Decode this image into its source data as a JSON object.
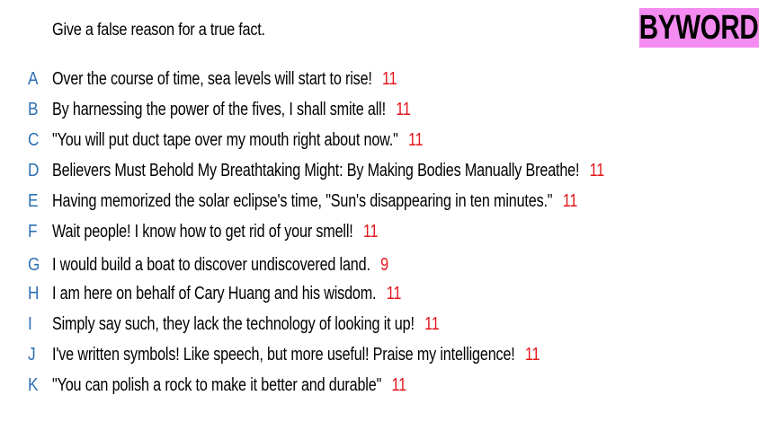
{
  "prompt": "Give a false reason for a true fact.",
  "logo_text": "BYWORD",
  "colors": {
    "letter": "#2d6fb3",
    "score": "#e3161b",
    "logo_bg": "#f48bf0"
  },
  "entries": [
    {
      "letter": "A",
      "text": "Over the course of time, sea levels will start to rise!",
      "score": "11"
    },
    {
      "letter": "B",
      "text": "By harnessing the power of the fives, I shall smite all!",
      "score": "11"
    },
    {
      "letter": "C",
      "text": "\"You will put duct tape over my mouth right about now.\"",
      "score": "11"
    },
    {
      "letter": "D",
      "text": "Believers Must Behold My Breathtaking Might: By Making Bodies Manually Breathe!",
      "score": "11"
    },
    {
      "letter": "E",
      "text": "Having memorized the solar eclipse's time, \"Sun's disappearing in ten minutes.\"",
      "score": "11"
    },
    {
      "letter": "F",
      "text": "Wait people! I know how to get rid of your smell!",
      "score": "11"
    },
    {
      "letter": "G",
      "text": "I would build a boat to discover undiscovered land.",
      "score": "9"
    },
    {
      "letter": "H",
      "text": "I am here on behalf of Cary Huang and his wisdom.",
      "score": "11"
    },
    {
      "letter": "I",
      "text": "Simply say such, they lack the technology of looking it up!",
      "score": "11"
    },
    {
      "letter": "J",
      "text": "I've written symbols! Like speech, but more useful! Praise my intelligence!",
      "score": "11"
    },
    {
      "letter": "K",
      "text": "\"You can polish a rock to make it better and durable\"",
      "score": "11"
    }
  ]
}
